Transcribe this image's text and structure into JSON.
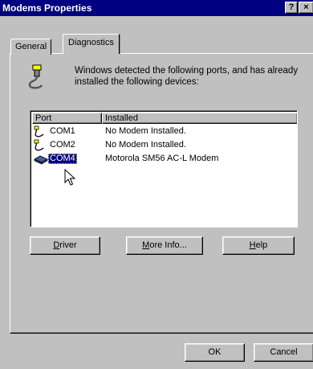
{
  "window": {
    "title": "Modems Properties",
    "help_button": "?",
    "close_button": "×"
  },
  "tabs": [
    {
      "label": "General",
      "selected": false
    },
    {
      "label": "Diagnostics",
      "selected": true
    }
  ],
  "intro_text": "Windows detected the following ports, and has already installed the following devices:",
  "list": {
    "columns": [
      "Port",
      "Installed"
    ],
    "rows": [
      {
        "port": "COM1",
        "installed": "No Modem Installed.",
        "icon": "serial-port-icon",
        "selected": false
      },
      {
        "port": "COM2",
        "installed": "No Modem Installed.",
        "icon": "serial-port-icon",
        "selected": false
      },
      {
        "port": "COM4",
        "installed": "Motorola SM56 AC-L Modem",
        "icon": "modem-icon",
        "selected": true
      }
    ]
  },
  "buttons": {
    "driver": {
      "pre": "",
      "mnemonic": "D",
      "post": "river"
    },
    "more_info": {
      "pre": "",
      "mnemonic": "M",
      "post": "ore Info..."
    },
    "help": {
      "pre": "",
      "mnemonic": "H",
      "post": "elp"
    },
    "ok": "OK",
    "cancel": "Cancel"
  },
  "colors": {
    "titlebar": "#000080",
    "face": "#c0c0c0",
    "selection": "#000080"
  }
}
